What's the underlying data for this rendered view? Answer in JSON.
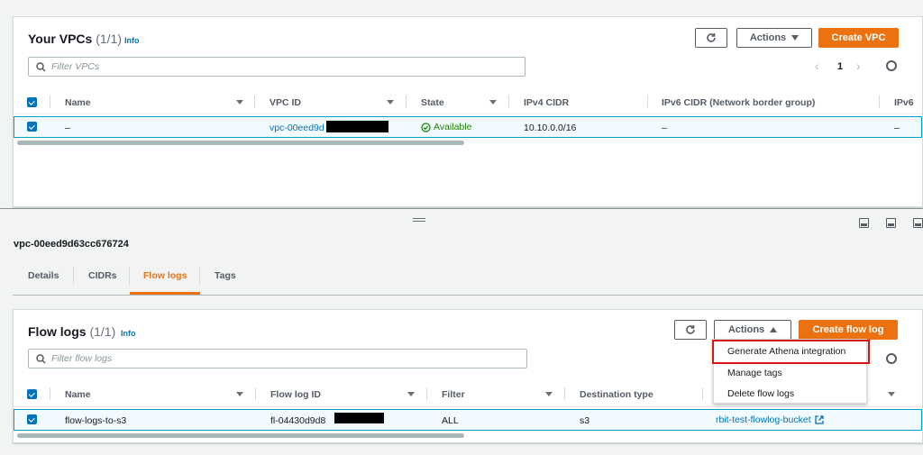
{
  "vpcs": {
    "title": "Your VPCs",
    "count": "(1/1)",
    "info": "Info",
    "refresh_icon": "refresh-icon",
    "actions_label": "Actions",
    "create_label": "Create VPC",
    "search_placeholder": "Filter VPCs",
    "page": "1",
    "columns": [
      "Name",
      "VPC ID",
      "State",
      "IPv4 CIDR",
      "IPv6 CIDR (Network border group)",
      "IPv6"
    ],
    "row": {
      "name": "–",
      "vpc_id": "vpc-00eed9d",
      "state": "Available",
      "ipv4": "10.10.0.0/16",
      "ipv6": "–",
      "ipv6b": "–"
    }
  },
  "details": {
    "vpc_title": "vpc-00eed9d63cc676724",
    "tabs": [
      "Details",
      "CIDRs",
      "Flow logs",
      "Tags"
    ],
    "active_tab": "Flow logs"
  },
  "flowlogs": {
    "title": "Flow logs",
    "count": "(1/1)",
    "info": "Info",
    "actions_label": "Actions",
    "create_label": "Create flow log",
    "search_placeholder": "Filter flow logs",
    "columns": [
      "Name",
      "Flow log ID",
      "Filter",
      "Destination type"
    ],
    "row": {
      "name": "flow-logs-to-s3",
      "id": "fl-04430d9d8",
      "filter": "ALL",
      "dest_type": "s3",
      "dest": "rbit-test-flowlog-bucket"
    },
    "menu": [
      "Generate Athena integration",
      "Manage tags",
      "Delete flow logs"
    ]
  },
  "colors": {
    "accent": "#ec7211",
    "link": "#0073bb",
    "success": "#1d8102",
    "highlight": "#d91515"
  }
}
